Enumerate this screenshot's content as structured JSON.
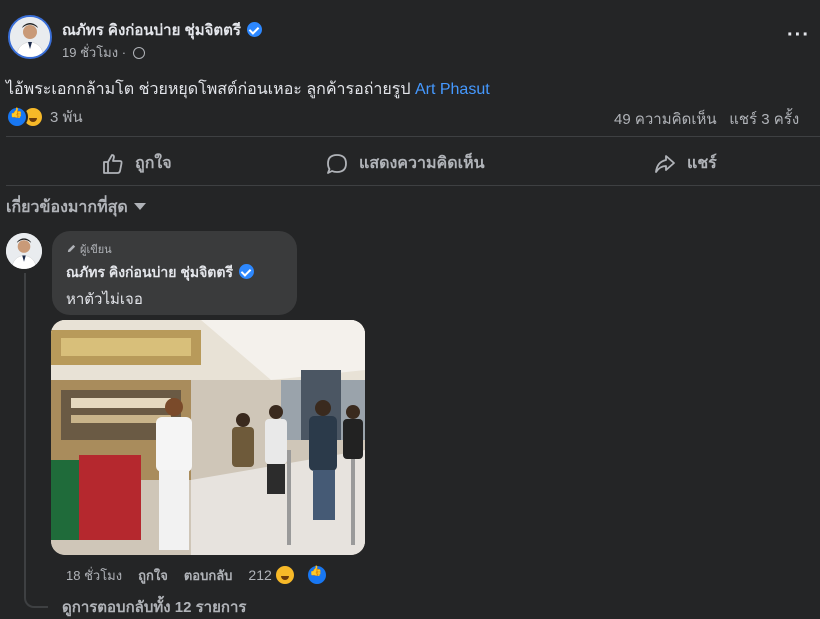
{
  "post": {
    "author_name": "ณภัทร คิงก่อนบ่าย ชุ่มจิตตรี",
    "timestamp": "19 ชั่วโมง ·",
    "text": "ไอ้พระเอกกล้ามโต ช่วยหยุดโพสต์ก่อนเหอะ ลูกค้ารอถ่ายรูป ",
    "mention": "Art Phasut",
    "reaction_count": "3 พัน",
    "comments_count": "49 ความคิดเห็น",
    "shares_count": "แชร์ 3 ครั้ง"
  },
  "actions": {
    "like_label": "ถูกใจ",
    "comment_label": "แสดงความคิดเห็น",
    "share_label": "แชร์"
  },
  "filter": {
    "label": "เกี่ยวข้องมากที่สุด"
  },
  "comment": {
    "badge": "ผู้เขียน",
    "author_name": "ณภัทร คิงก่อนบ่าย ชุ่มจิตตรี",
    "text": "หาตัวไม่เจอ",
    "time": "18 ชั่วโมง",
    "like_label": "ถูกใจ",
    "reply_label": "ตอบกลับ",
    "reaction_count": "212"
  },
  "view_replies": {
    "label": "ดูการตอบกลับทั้ง 12 รายการ"
  },
  "colors": {
    "background": "#242526",
    "accent": "#2d88ff",
    "link": "#4599ff",
    "secondary_text": "#b0b3b8"
  }
}
